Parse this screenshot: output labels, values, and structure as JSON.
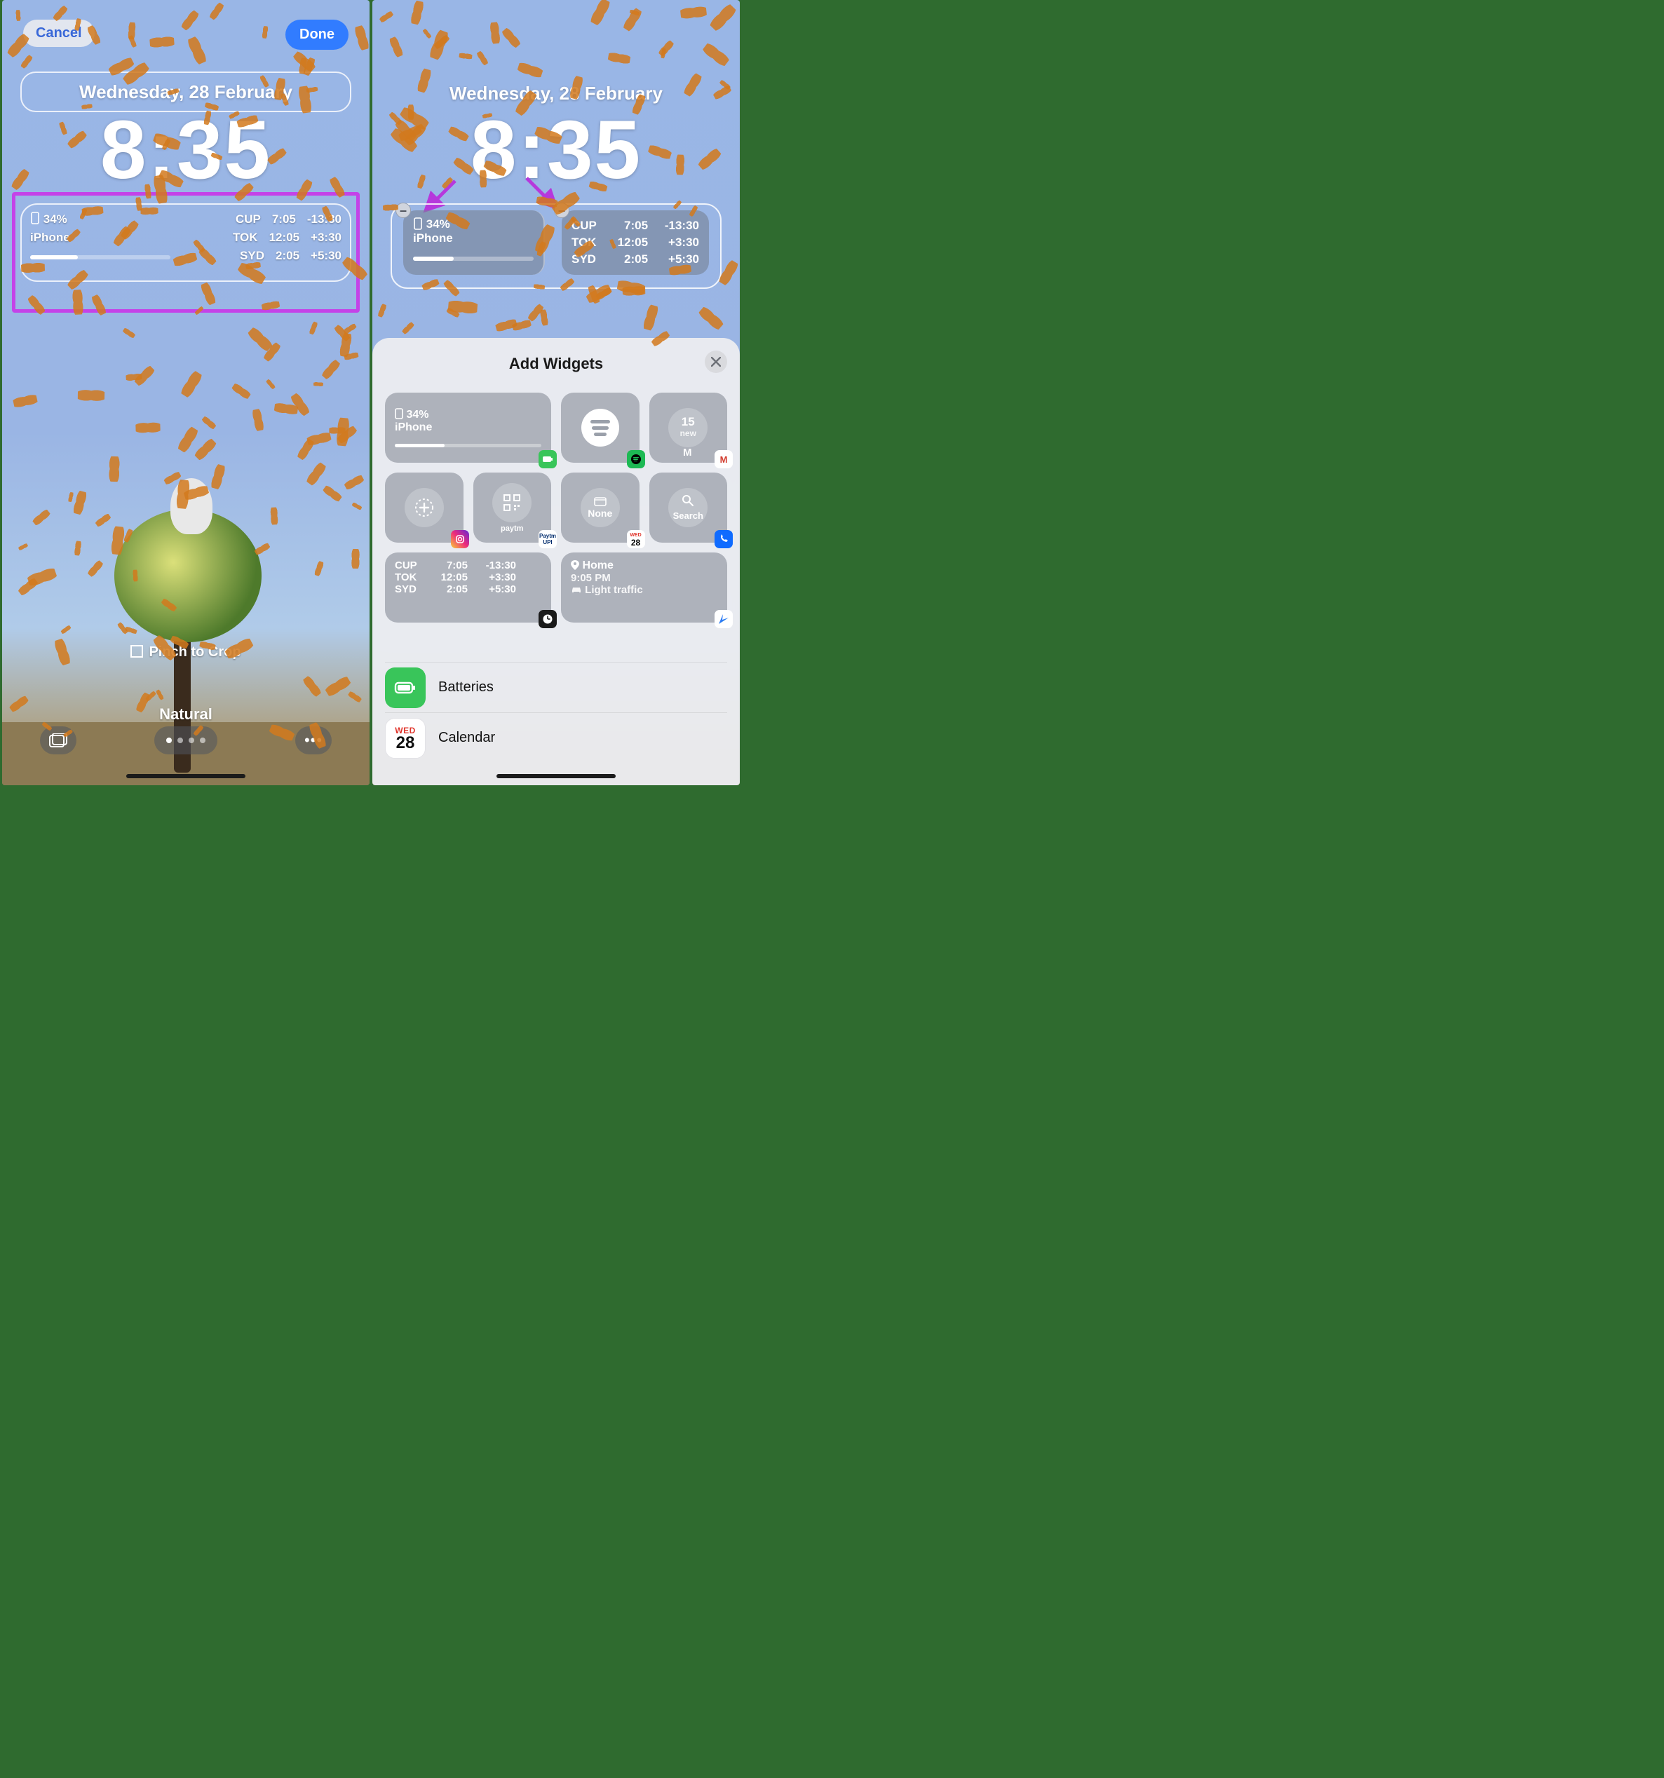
{
  "left": {
    "cancel": "Cancel",
    "done": "Done",
    "date": "Wednesday, 28 February",
    "time": "8:35",
    "battery": {
      "percent": "34%",
      "device": "iPhone"
    },
    "clocks": [
      {
        "city": "CUP",
        "time": "7:05",
        "offset": "-13:30"
      },
      {
        "city": "TOK",
        "time": "12:05",
        "offset": "+3:30"
      },
      {
        "city": "SYD",
        "time": "2:05",
        "offset": "+5:30"
      }
    ],
    "hint": "Pinch to Crop",
    "filter": "Natural"
  },
  "right": {
    "date": "Wednesday, 28 February",
    "time": "8:35",
    "battery": {
      "percent": "34%",
      "device": "iPhone"
    },
    "clocks": [
      {
        "city": "CUP",
        "time": "7:05",
        "offset": "-13:30"
      },
      {
        "city": "TOK",
        "time": "12:05",
        "offset": "+3:30"
      },
      {
        "city": "SYD",
        "time": "2:05",
        "offset": "+5:30"
      }
    ],
    "sheet": {
      "title": "Add Widgets",
      "suggestions": {
        "battery": {
          "percent": "34%",
          "device": "iPhone"
        },
        "gmail": {
          "count": "15",
          "label": "new"
        },
        "calendar": {
          "label": "None"
        },
        "search": {
          "label": "Search"
        },
        "clocks": [
          {
            "city": "CUP",
            "time": "7:05",
            "offset": "-13:30"
          },
          {
            "city": "TOK",
            "time": "12:05",
            "offset": "+3:30"
          },
          {
            "city": "SYD",
            "time": "2:05",
            "offset": "+5:30"
          }
        ],
        "maps": {
          "title": "Home",
          "time": "9:05 PM",
          "traffic": "Light traffic"
        },
        "cal_badge": {
          "dow": "WED",
          "day": "28"
        }
      },
      "apps": [
        {
          "name": "Batteries",
          "color": "#39c55a"
        },
        {
          "name": "Calendar",
          "dow": "WED",
          "day": "28"
        }
      ]
    }
  }
}
